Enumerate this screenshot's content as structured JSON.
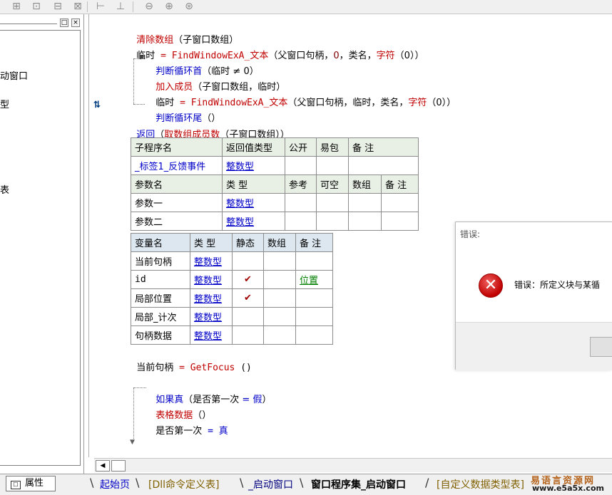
{
  "toolbar": {
    "icons": [
      "toolbar-icon-1",
      "toolbar-icon-2",
      "toolbar-icon-3",
      "toolbar-icon-4",
      "toolbar-icon-5",
      "toolbar-icon-6",
      "toolbar-icon-7",
      "toolbar-icon-8",
      "toolbar-icon-9"
    ]
  },
  "left_panel": {
    "btn_restore": "□",
    "btn_close": "×",
    "items": [
      "动窗口",
      "型",
      "表"
    ]
  },
  "code": {
    "line1_cmd": "清除数组",
    "line1_args": "（子窗口数组）",
    "line2_var": "临时",
    "line2_eq": " = ",
    "line2_fn": "FindWindowExA_文本",
    "line2_args_a": "（父窗口句柄，",
    "line2_zero": "0",
    "line2_args_b": "，类名，",
    "line2_fn2": "字符",
    "line2_args_c": "（0））",
    "loop_head": "判断循环首",
    "loop_head_args": "（临时 ≠ 0）",
    "add_member": "加入成员",
    "add_member_args": "（子窗口数组，临时）",
    "line5_var": "临时",
    "line5_eq": " = ",
    "line5_fn": "FindWindowExA_文本",
    "line5_args_a": "（父窗口句柄，临时，类名，",
    "line5_fn2": "字符",
    "line5_args_c": "（0））",
    "loop_tail": "判断循环尾",
    "loop_tail_args": "（）",
    "return_kw": "返回",
    "return_args_a": "（",
    "return_fn": "取数组成员数",
    "return_args_b": "（子窗口数组））"
  },
  "sub_table": {
    "headers": [
      "子程序名",
      "返回值类型",
      "公开",
      "易包",
      "备 注"
    ],
    "name": "_标签1_反馈事件",
    "ret_type": "整数型",
    "param_headers": [
      "参数名",
      "类 型",
      "参考",
      "可空",
      "数组",
      "备 注"
    ],
    "params": [
      {
        "name": "参数一",
        "type": "整数型"
      },
      {
        "name": "参数二",
        "type": "整数型"
      }
    ]
  },
  "var_table": {
    "headers": [
      "变量名",
      "类 型",
      "静态",
      "数组",
      "备 注"
    ],
    "rows": [
      {
        "name": "当前句柄",
        "type": "整数型",
        "static": "",
        "array": "",
        "note": ""
      },
      {
        "name": "id",
        "type": "整数型",
        "static": "✔",
        "array": "",
        "note": "位置"
      },
      {
        "name": "局部位置",
        "type": "整数型",
        "static": "✔",
        "array": "",
        "note": ""
      },
      {
        "name": "局部_计次",
        "type": "整数型",
        "static": "",
        "array": "",
        "note": ""
      },
      {
        "name": "句柄数据",
        "type": "整数型",
        "static": "",
        "array": "",
        "note": ""
      }
    ]
  },
  "code2": {
    "focus_var": "当前句柄",
    "focus_eq": " = ",
    "focus_fn": "GetFocus",
    "focus_args": " ()",
    "if_kw": "如果真",
    "if_args_a": "（是否第一次 ",
    "if_eq": "=",
    "if_false": " 假",
    "if_args_b": "）",
    "table_fn": "表格数据",
    "table_args": "（）",
    "assign_var": "是否第一次",
    "assign_eq": " = ",
    "assign_true": "真"
  },
  "dialog": {
    "title": "错误:",
    "message": "错误：所定义块与某循"
  },
  "tabs": {
    "properties": "属性",
    "items": [
      "起始页",
      "[Dll命令定义表]",
      "_启动窗口",
      "窗口程序集_启动窗口",
      "[自定义数据类型表]"
    ]
  },
  "brand": {
    "name": "易语言资源网",
    "url": "www.e5a5x.com"
  }
}
